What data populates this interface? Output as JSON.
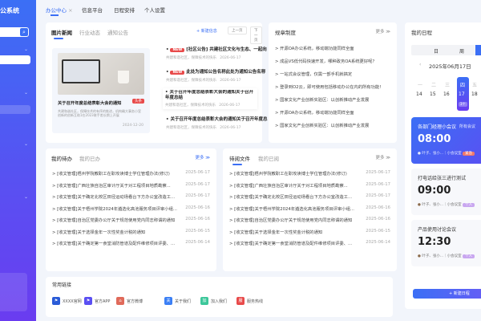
{
  "sidebar": {
    "title": "公系统",
    "search_placeholder": ""
  },
  "nav": {
    "tabs": [
      {
        "label": "办公中心",
        "active": true
      },
      {
        "label": "信息平台"
      },
      {
        "label": "日程安排"
      },
      {
        "label": "个人设置"
      }
    ],
    "close": "×"
  },
  "news": {
    "tabs": [
      "图片新闻",
      "行业动态",
      "通知公告"
    ],
    "add": "+ 新建信息",
    "prev": "上一页",
    "next": "下一页",
    "feature": {
      "title": "关于召开年度总结表彰大会的通知",
      "badge": "头条",
      "desc": "共建和谐社区，保障技术的有序的推进，机构确大事务小室创新的创新互助1在2023联手差长期上开展",
      "date": "2024-12-20"
    },
    "items": [
      {
        "new": true,
        "title": "[社区公告] 共建社区文化与生态、一起向",
        "meta": "共建和谐社区，保障技术的快乐",
        "date": "2026-06-17"
      },
      {
        "new": true,
        "title": "此处为通知公告名称此处为通知公告名称",
        "meta": "共建和谐社区，保障技术的快乐",
        "date": "2026-06-17"
      },
      {
        "new": false,
        "title": "关于召开年度总结表彰大会的通知关于召开年度总结",
        "meta": "共建和谐社区，保障技术的快乐",
        "date": "2026-06-17"
      },
      {
        "new": false,
        "title": "关于召开年度总结表彰大会的通知关于召开年度总",
        "meta": "共建和谐社区，保障技术的快乐",
        "date": "2026-06-17"
      }
    ]
  },
  "rules": {
    "title": "规章制度",
    "more": "更多 ≫",
    "items": [
      "> 开源OA办公系统，移动端功能同样全面",
      "> 成品VS低代码快速开发，哪种政务OA系统更好呢？",
      "> 一站式会议管理，仅需一部手机就搞定",
      "> 登录到O2云，即可使用包括移动办公在内的所有功能!",
      "> 国家文化产业创新实验区：以创新推动产业发展",
      "> 开源OA办公系统，移动端功能同样全面",
      "> 国家文化产业创新实验区：以创新推动产业发展"
    ]
  },
  "calendar": {
    "title": "我的日程",
    "views": [
      "日",
      "周",
      "月"
    ],
    "date": "2025年06月17日",
    "weekdays": [
      "一",
      "二",
      "三",
      "四",
      "五"
    ],
    "days": [
      "14",
      "15",
      "16",
      "17",
      "18"
    ],
    "today_badge": "3个",
    "add": "+ 新建日程",
    "events": [
      {
        "name": "各部门经理小会议",
        "time": "08:00",
        "people": "叶子、张小...｜小会议室",
        "tag": "紧急",
        "tag2": "所有会议"
      },
      {
        "name": "打电话给张三进行测试",
        "time": "09:00",
        "people": "叶子、张小...｜小会议室",
        "tag": "个人"
      },
      {
        "name": "产品使用讨论会议",
        "time": "12:30",
        "people": "叶子、张小...｜小会议室",
        "tag": "个人"
      }
    ]
  },
  "todo": {
    "tabs": [
      "我的待办",
      "我的已办"
    ],
    "more": "更多 ≫",
    "rows": [
      [
        "> [收文管理]梧州学院教职工在职攻读博士学位管理办法(修订)",
        "2025-06-17"
      ],
      [
        "> [收文管理]广西壮族自治区审计厅关于对工程项目地质勘察...",
        "2025-06-17"
      ],
      [
        "> [收文管理]关于确定北校区田径运动场看台下方办公室改造工...",
        "2025-06-17"
      ],
      [
        "> [收文管理]关于梧州学院2024年遴选化高池服务项目评审小组...",
        "2025-06-16"
      ],
      [
        "> [收文管理]自治区党委办公厅关于规范使用党内同志称谓的通知",
        "2025-06-16"
      ],
      [
        "> [收文管理]关于选择金年一次性奖金计税的通知",
        "2025-06-15"
      ],
      [
        "> [收文管理]关于确定第一食堂消防管道及配件维修项目评委、...",
        "2025-06-14"
      ]
    ]
  },
  "docs": {
    "tabs": [
      "待阅文件",
      "我的已阅"
    ],
    "more": "更多 ≫",
    "rows": [
      [
        "> [收文管理]梧州学院教职工在职攻读博士学位管理办法(修订)",
        "2025-06-17"
      ],
      [
        "> [收文管理]广西壮族自治区审计厅关于对工程项目地质勘察...",
        "2025-06-17"
      ],
      [
        "> [收文管理]关于确定北校区田径运动场看台下方办公室改造工...",
        "2025-06-17"
      ],
      [
        "> [收文管理]关于梧州学院2024年遴选化高池服务项目评审小组...",
        "2025-06-16"
      ],
      [
        "> [收文管理]自治区党委办公厅关于规范使用党内同志称谓的通知",
        "2025-06-16"
      ],
      [
        "> [收文管理]关于选择金年一次性奖金计税的通知",
        "2025-06-15"
      ],
      [
        "> [收文管理]关于确定第一食堂消防管道及配件维修项目评委、...",
        "2025-06-14"
      ]
    ]
  },
  "links": {
    "title": "常用链接",
    "items": [
      {
        "label": "XXXX官网",
        "color": "#2a5bd7"
      },
      {
        "label": "官方APP",
        "color": "#5a4ff2"
      },
      {
        "label": "官方微博",
        "color": "#e06a5a"
      },
      {
        "label": "关于我们",
        "color": "#3b7ff5"
      },
      {
        "label": "加入我们",
        "color": "#3cc79a"
      },
      {
        "label": "服务热线",
        "color": "#e84a4a"
      }
    ]
  }
}
